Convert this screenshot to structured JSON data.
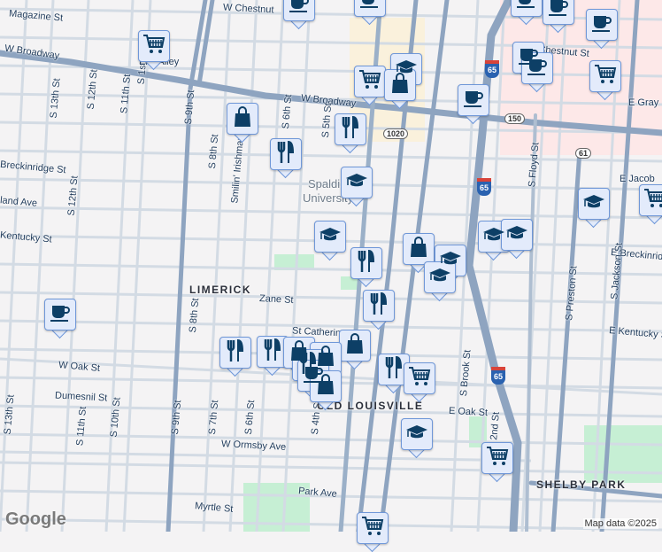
{
  "streets": [
    "Magazine St",
    "W Chestnut",
    "W Broadway",
    "E Chestnut St",
    "W Broadway",
    "E Gray",
    "Breckinridge St",
    "S 13th St",
    "S 12th St",
    "S 11th St",
    "S 9th St",
    "S 8th St",
    "Smilin' Irishman",
    "S 6th St",
    "S 5th St",
    "S 1st St",
    "S Floyd St",
    "E Jacob",
    "Kentucky St",
    "land Ave",
    "E Breckinridge",
    "Zane St",
    "St Catherine",
    "S 8th St",
    "E Kentucky St",
    "W Oak St",
    "Dumesnil St",
    "S 13th St",
    "S 11th St",
    "S 10th St",
    "S 9th St",
    "S 7th St",
    "S 6th St",
    "S 4th St",
    "S Brook St",
    "S Preston St",
    "S Jackson St",
    "E Oak St",
    "W Ormsby Ave",
    "Park Ave",
    "Myrtle St",
    "S 12th St",
    "S 2nd St",
    "Elm Alley"
  ],
  "neighborhoods": [
    "LIMERICK",
    "OLD LOUISVILLE",
    "SHELBY PARK"
  ],
  "university": [
    "Spalding",
    "University"
  ],
  "shields": {
    "us150": "150",
    "ky1020": "1020",
    "ky61": "61",
    "i65": "65"
  },
  "markers": [
    "coffee",
    "coffee",
    "cart",
    "coffee",
    "coffee",
    "coffee",
    "coffee",
    "coffee",
    "cart",
    "graduation",
    "cart",
    "bag",
    "coffee",
    "bag",
    "food",
    "food",
    "graduation",
    "graduation",
    "cart",
    "graduation",
    "bag",
    "food",
    "graduation",
    "graduation",
    "graduation",
    "graduation",
    "food",
    "coffee",
    "bag",
    "food",
    "food",
    "bag",
    "bag",
    "food",
    "coffee",
    "bag",
    "food",
    "cart",
    "graduation",
    "cart",
    "cart"
  ],
  "footer": {
    "logo": "Google",
    "attribution": "Map data ©2025"
  },
  "colors": {
    "marker_bg": "#e3ebfb",
    "marker_icon": "#0d3f66",
    "arterial": "#8ea4c0",
    "street": "#d3dbe4",
    "park": "#c6efd4"
  }
}
